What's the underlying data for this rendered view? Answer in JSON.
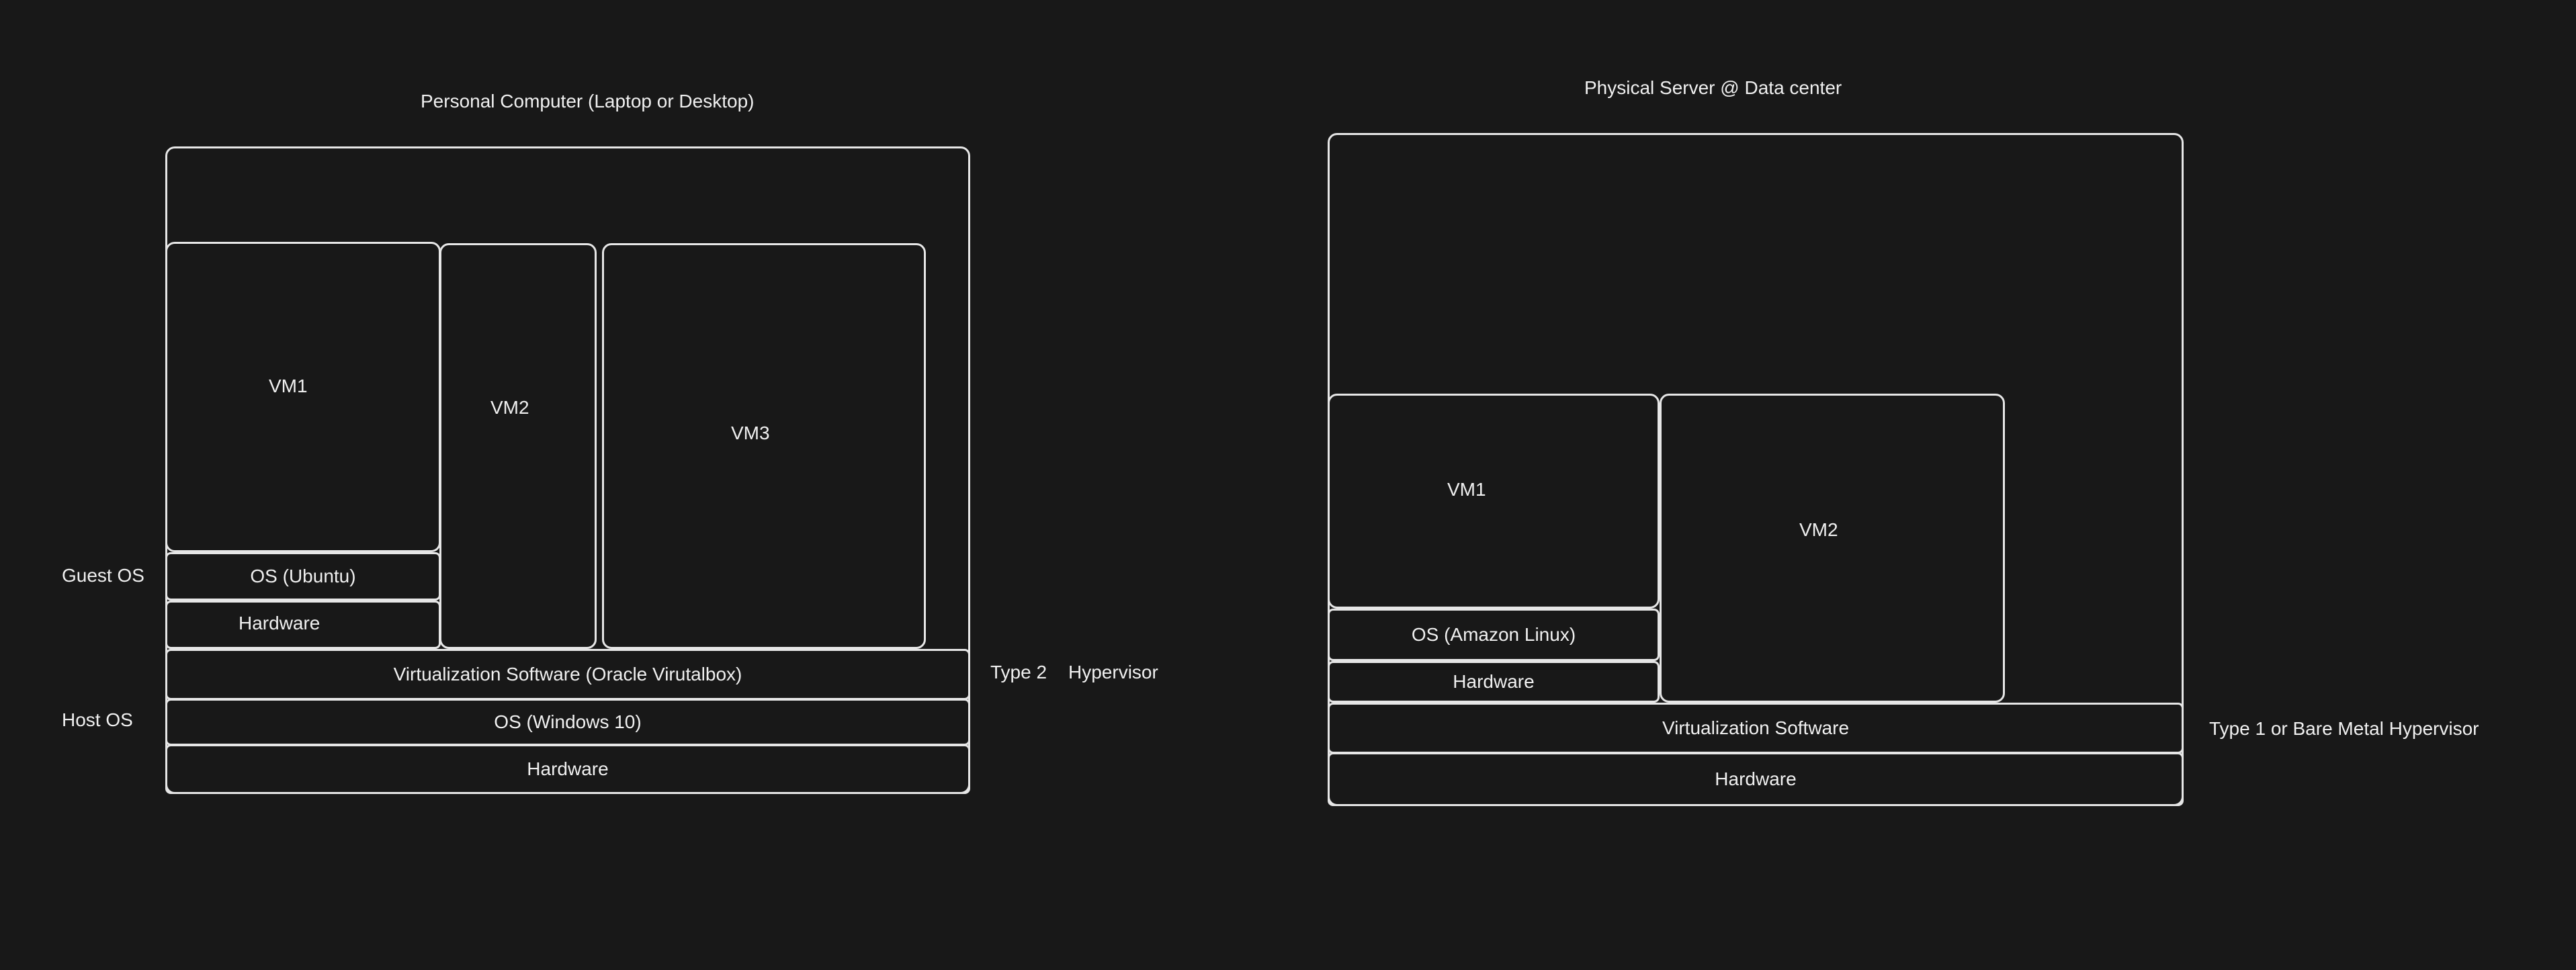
{
  "left_diagram": {
    "title": "Personal Computer (Laptop or Desktop)",
    "vm1": "VM1",
    "vm2": "VM2",
    "vm3": "VM3",
    "guest_os_label": "Guest OS",
    "guest_os": "OS (Ubuntu)",
    "guest_hardware": "Hardware",
    "virtualization": "Virtualization Software (Oracle Virutalbox)",
    "hypervisor_type": "Type 2",
    "hypervisor_word": "Hypervisor",
    "host_os_label": "Host OS",
    "host_os": "OS (Windows 10)",
    "host_hardware": "Hardware"
  },
  "right_diagram": {
    "title": "Physical Server @ Data center",
    "vm1": "VM1",
    "vm2": "VM2",
    "guest_os": "OS (Amazon Linux)",
    "guest_hardware": "Hardware",
    "virtualization": "Virtualization Software",
    "hypervisor_label": "Type 1 or Bare Metal Hypervisor",
    "hardware": "Hardware"
  }
}
